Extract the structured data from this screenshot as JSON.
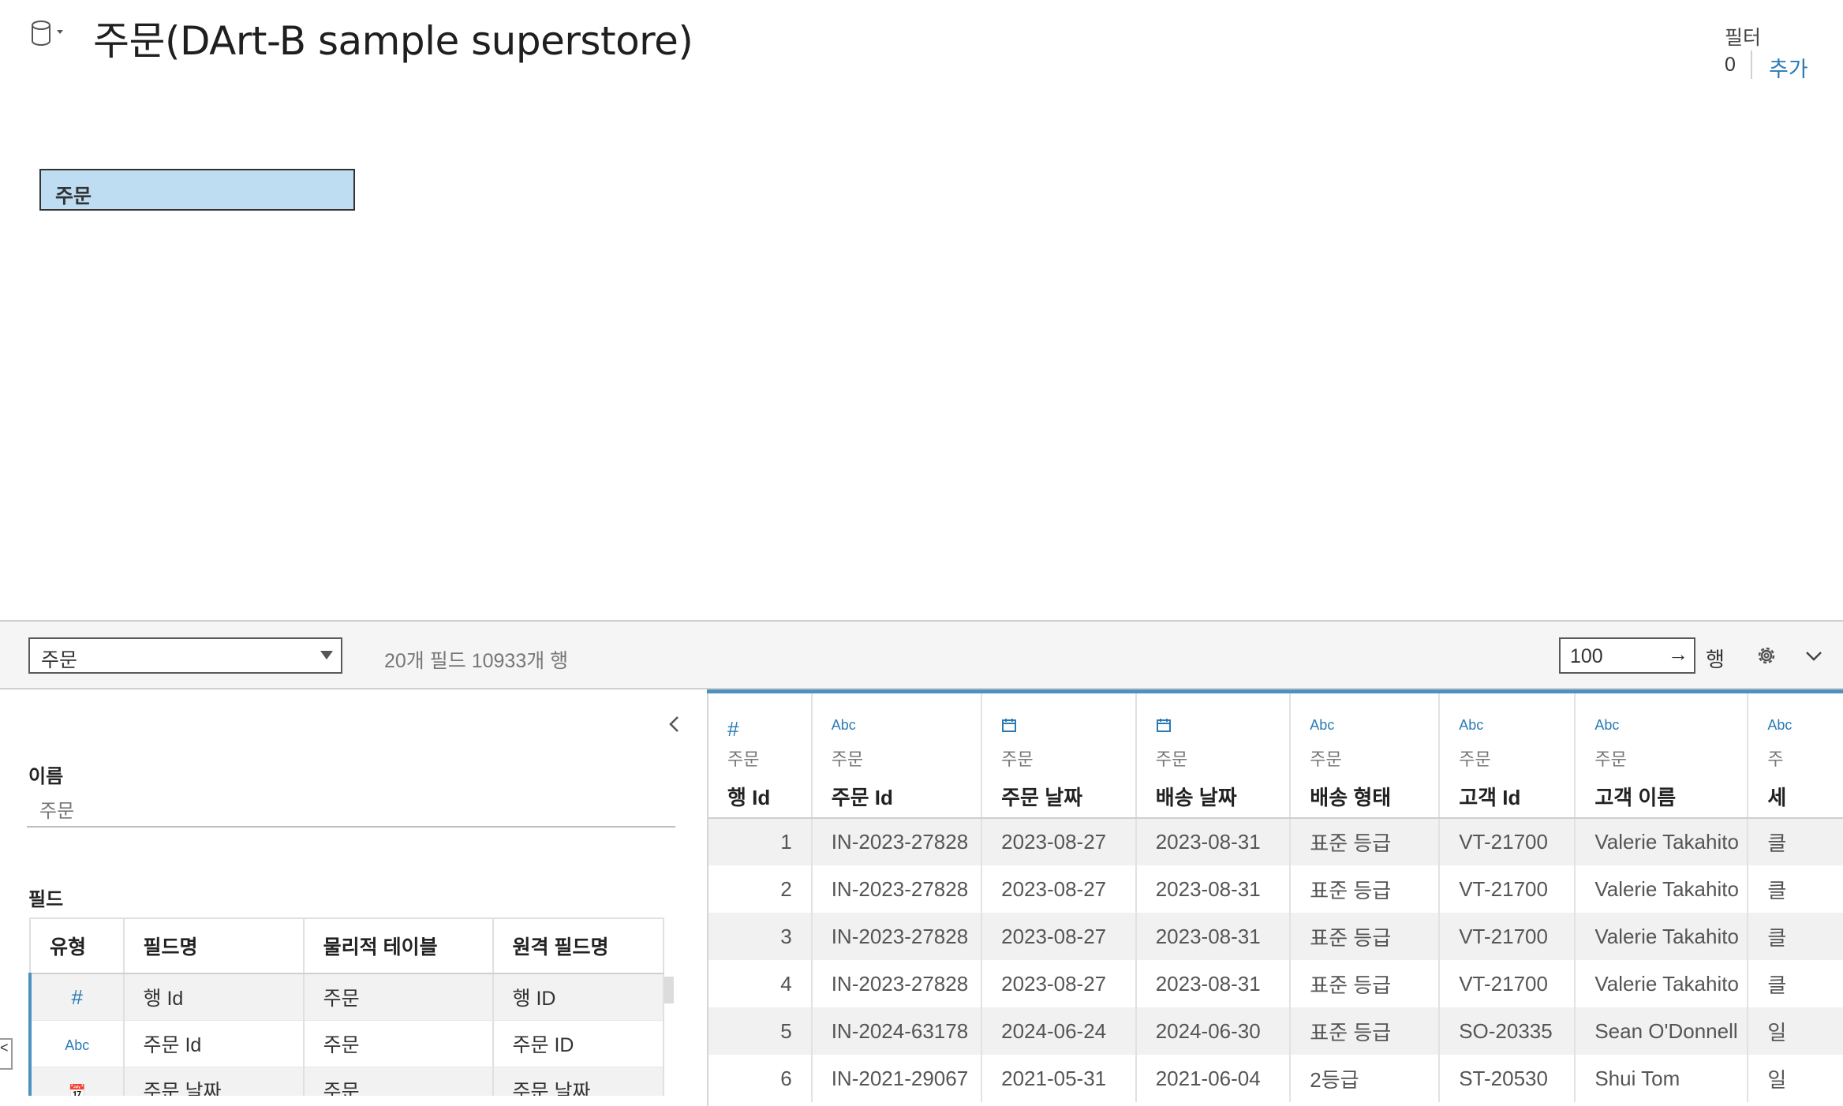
{
  "header": {
    "title": "주문(DArt-B sample superstore)",
    "datasource_icon": "database-icon",
    "filter_label": "필터",
    "filter_count": "0",
    "filter_add": "추가"
  },
  "canvas": {
    "table_card": "주문"
  },
  "toolbar": {
    "table_select": "주문",
    "field_stats": "20개 필드 10933개 행",
    "row_count": "100",
    "row_arrow": "→",
    "row_label": "행"
  },
  "metadata": {
    "name_label": "이름",
    "name_value": "주문",
    "fields_label": "필드",
    "columns": [
      "유형",
      "필드명",
      "물리적 테이블",
      "원격 필드명"
    ],
    "rows": [
      {
        "type": "#",
        "field": "행 Id",
        "table": "주문",
        "remote": "행 ID"
      },
      {
        "type": "Abc",
        "field": "주문 Id",
        "table": "주문",
        "remote": "주문 ID"
      },
      {
        "type": "📅",
        "field": "주문 날짜",
        "table": "주문",
        "remote": "주문 날짜"
      }
    ]
  },
  "grid": {
    "columns": [
      {
        "type": "#",
        "source": "주문",
        "name": "행 Id"
      },
      {
        "type": "Abc",
        "source": "주문",
        "name": "주문 Id"
      },
      {
        "type": "date",
        "source": "주문",
        "name": "주문 날짜"
      },
      {
        "type": "date",
        "source": "주문",
        "name": "배송 날짜"
      },
      {
        "type": "Abc",
        "source": "주문",
        "name": "배송 형태"
      },
      {
        "type": "Abc",
        "source": "주문",
        "name": "고객 Id"
      },
      {
        "type": "Abc",
        "source": "주문",
        "name": "고객 이름"
      },
      {
        "type": "Abc",
        "source": "주",
        "name": "세"
      }
    ],
    "rows": [
      [
        "1",
        "IN-2023-27828",
        "2023-08-27",
        "2023-08-31",
        "표준 등급",
        "VT-21700",
        "Valerie Takahito",
        "클"
      ],
      [
        "2",
        "IN-2023-27828",
        "2023-08-27",
        "2023-08-31",
        "표준 등급",
        "VT-21700",
        "Valerie Takahito",
        "클"
      ],
      [
        "3",
        "IN-2023-27828",
        "2023-08-27",
        "2023-08-31",
        "표준 등급",
        "VT-21700",
        "Valerie Takahito",
        "클"
      ],
      [
        "4",
        "IN-2023-27828",
        "2023-08-27",
        "2023-08-31",
        "표준 등급",
        "VT-21700",
        "Valerie Takahito",
        "클"
      ],
      [
        "5",
        "IN-2024-63178",
        "2024-06-24",
        "2024-06-30",
        "표준 등급",
        "SO-20335",
        "Sean O'Donnell",
        "일"
      ],
      [
        "6",
        "IN-2021-29067",
        "2021-05-31",
        "2021-06-04",
        "2등급",
        "ST-20530",
        "Shui Tom",
        "일"
      ]
    ]
  }
}
